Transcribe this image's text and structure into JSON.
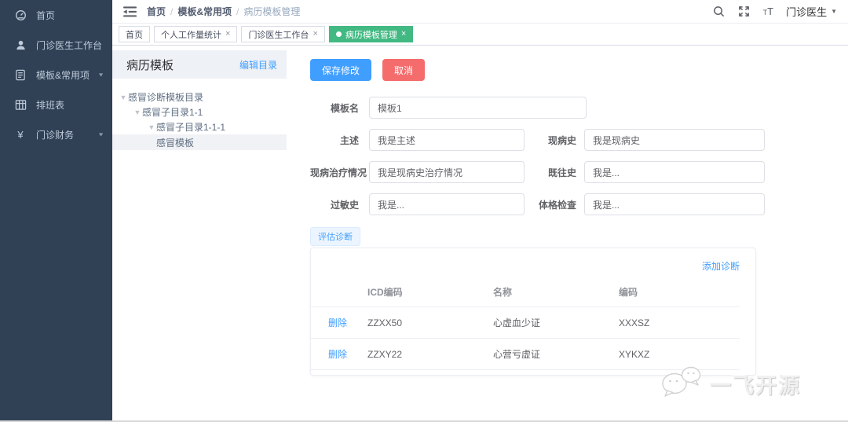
{
  "sidebar": {
    "items": [
      {
        "label": "首页",
        "icon": "dashboard-icon",
        "expandable": false
      },
      {
        "label": "门诊医生工作台",
        "icon": "doctor-workbench-icon",
        "expandable": false
      },
      {
        "label": "模板&常用项",
        "icon": "template-icon",
        "expandable": true
      },
      {
        "label": "排班表",
        "icon": "schedule-table-icon",
        "expandable": false
      },
      {
        "label": "门诊财务",
        "icon": "finance-yuan-icon",
        "expandable": true
      }
    ]
  },
  "navbar": {
    "breadcrumb": {
      "0": "首页",
      "1": "模板&常用项",
      "2": "病历模板管理",
      "separator": "/"
    },
    "user": {
      "name": "门诊医生"
    }
  },
  "tabs": {
    "0": {
      "label": "首页"
    },
    "1": {
      "label": "个人工作量统计",
      "close": "×"
    },
    "2": {
      "label": "门诊医生工作台",
      "close": "×"
    },
    "3": {
      "label": "病历模板管理",
      "close": "×"
    }
  },
  "tree_panel": {
    "title": "病历模板",
    "edit_link": "编辑目录",
    "caret": "▼",
    "nodes": {
      "0": {
        "label": "感冒诊断模板目录"
      },
      "1": {
        "label": "感冒子目录1-1"
      },
      "2": {
        "label": "感冒子目录1-1-1"
      },
      "3": {
        "label": "感冒模板"
      }
    }
  },
  "form": {
    "save_button": "保存修改",
    "cancel_button": "取消",
    "fields": {
      "0": {
        "label": "模板名",
        "value": "模板1"
      },
      "1": {
        "label": "主述",
        "value": "我是主述"
      },
      "2": {
        "label": "现病史",
        "value": "我是现病史"
      },
      "3": {
        "label": "现病治疗情况",
        "value": "我是现病史治疗情况"
      },
      "4": {
        "label": "既往史",
        "value": "我是..."
      },
      "5": {
        "label": "过敏史",
        "value": "我是..."
      },
      "6": {
        "label": "体格检查",
        "value": "我是..."
      }
    }
  },
  "diagnosis": {
    "tag": "评估诊断",
    "add_link": "添加诊断",
    "table": {
      "headers": {
        "action": "",
        "icd": "ICD编码",
        "name": "名称",
        "code": "编码"
      },
      "rows": {
        "0": {
          "action": "删除",
          "icd": "ZZXX50",
          "name": "心虚血少证",
          "code": "XXXSZ"
        },
        "1": {
          "action": "删除",
          "icd": "ZZXY22",
          "name": "心营亏虚证",
          "code": "XYKXZ"
        }
      }
    }
  },
  "watermark": {
    "text": "一飞开源"
  },
  "colors": {
    "sidebar_bg": "#304156",
    "sidebar_text": "#bfcbd9",
    "accent_blue": "#409eff",
    "danger_red": "#f56c6c",
    "active_tab_green": "#42b983",
    "panel_header_bg": "#eef1f6",
    "border_gray": "#dcdfe6"
  }
}
